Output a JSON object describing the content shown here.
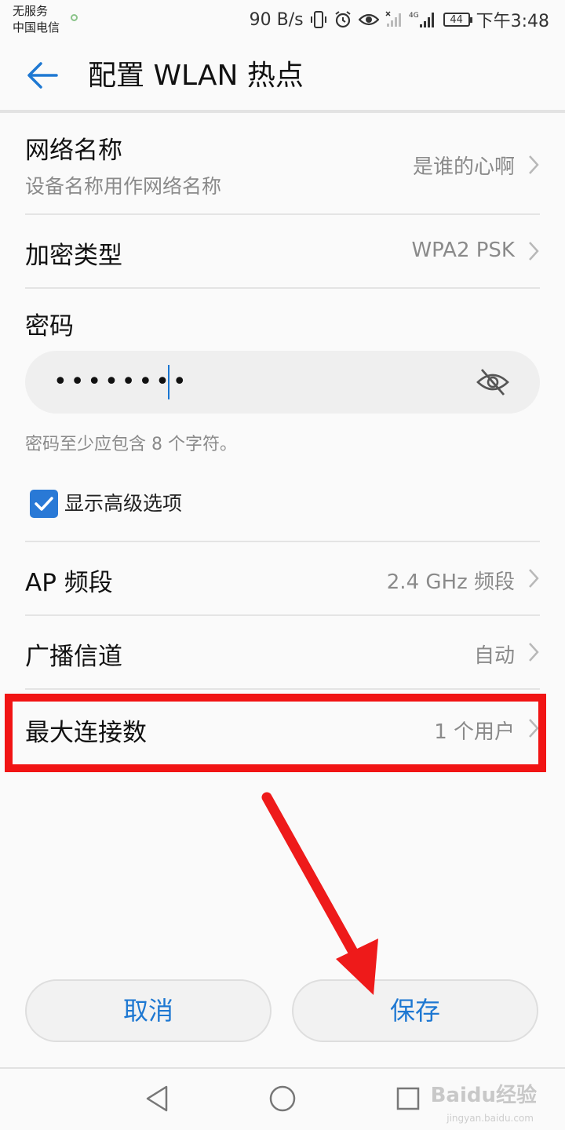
{
  "status_bar": {
    "carrier_line1": "无服务",
    "carrier_line2": "中国电信",
    "net_speed": "90 B/s",
    "battery": "44",
    "time": "下午3:48",
    "network_type": "4G"
  },
  "header": {
    "title": "配置 WLAN 热点",
    "back_icon": "back-arrow-icon"
  },
  "settings": {
    "network_name": {
      "label": "网络名称",
      "subtitle": "设备名称用作网络名称",
      "value": "是谁的心啊"
    },
    "encryption": {
      "label": "加密类型",
      "value": "WPA2 PSK"
    },
    "password": {
      "label": "密码",
      "value": "••••••••",
      "hint": "密码至少应包含 8 个字符。"
    },
    "advanced": {
      "label": "显示高级选项",
      "checked": true
    },
    "ap_band": {
      "label": "AP 频段",
      "value": "2.4 GHz 频段"
    },
    "channel": {
      "label": "广播信道",
      "value": "自动"
    },
    "max_connections": {
      "label": "最大连接数",
      "value": "1 个用户"
    }
  },
  "buttons": {
    "cancel": "取消",
    "save": "保存"
  },
  "colors": {
    "accent": "#1e78d2",
    "annotation_red": "#f11414",
    "checkbox": "#2979d6"
  },
  "watermark": {
    "brand": "Baidu经验",
    "url": "jingyan.baidu.com"
  }
}
